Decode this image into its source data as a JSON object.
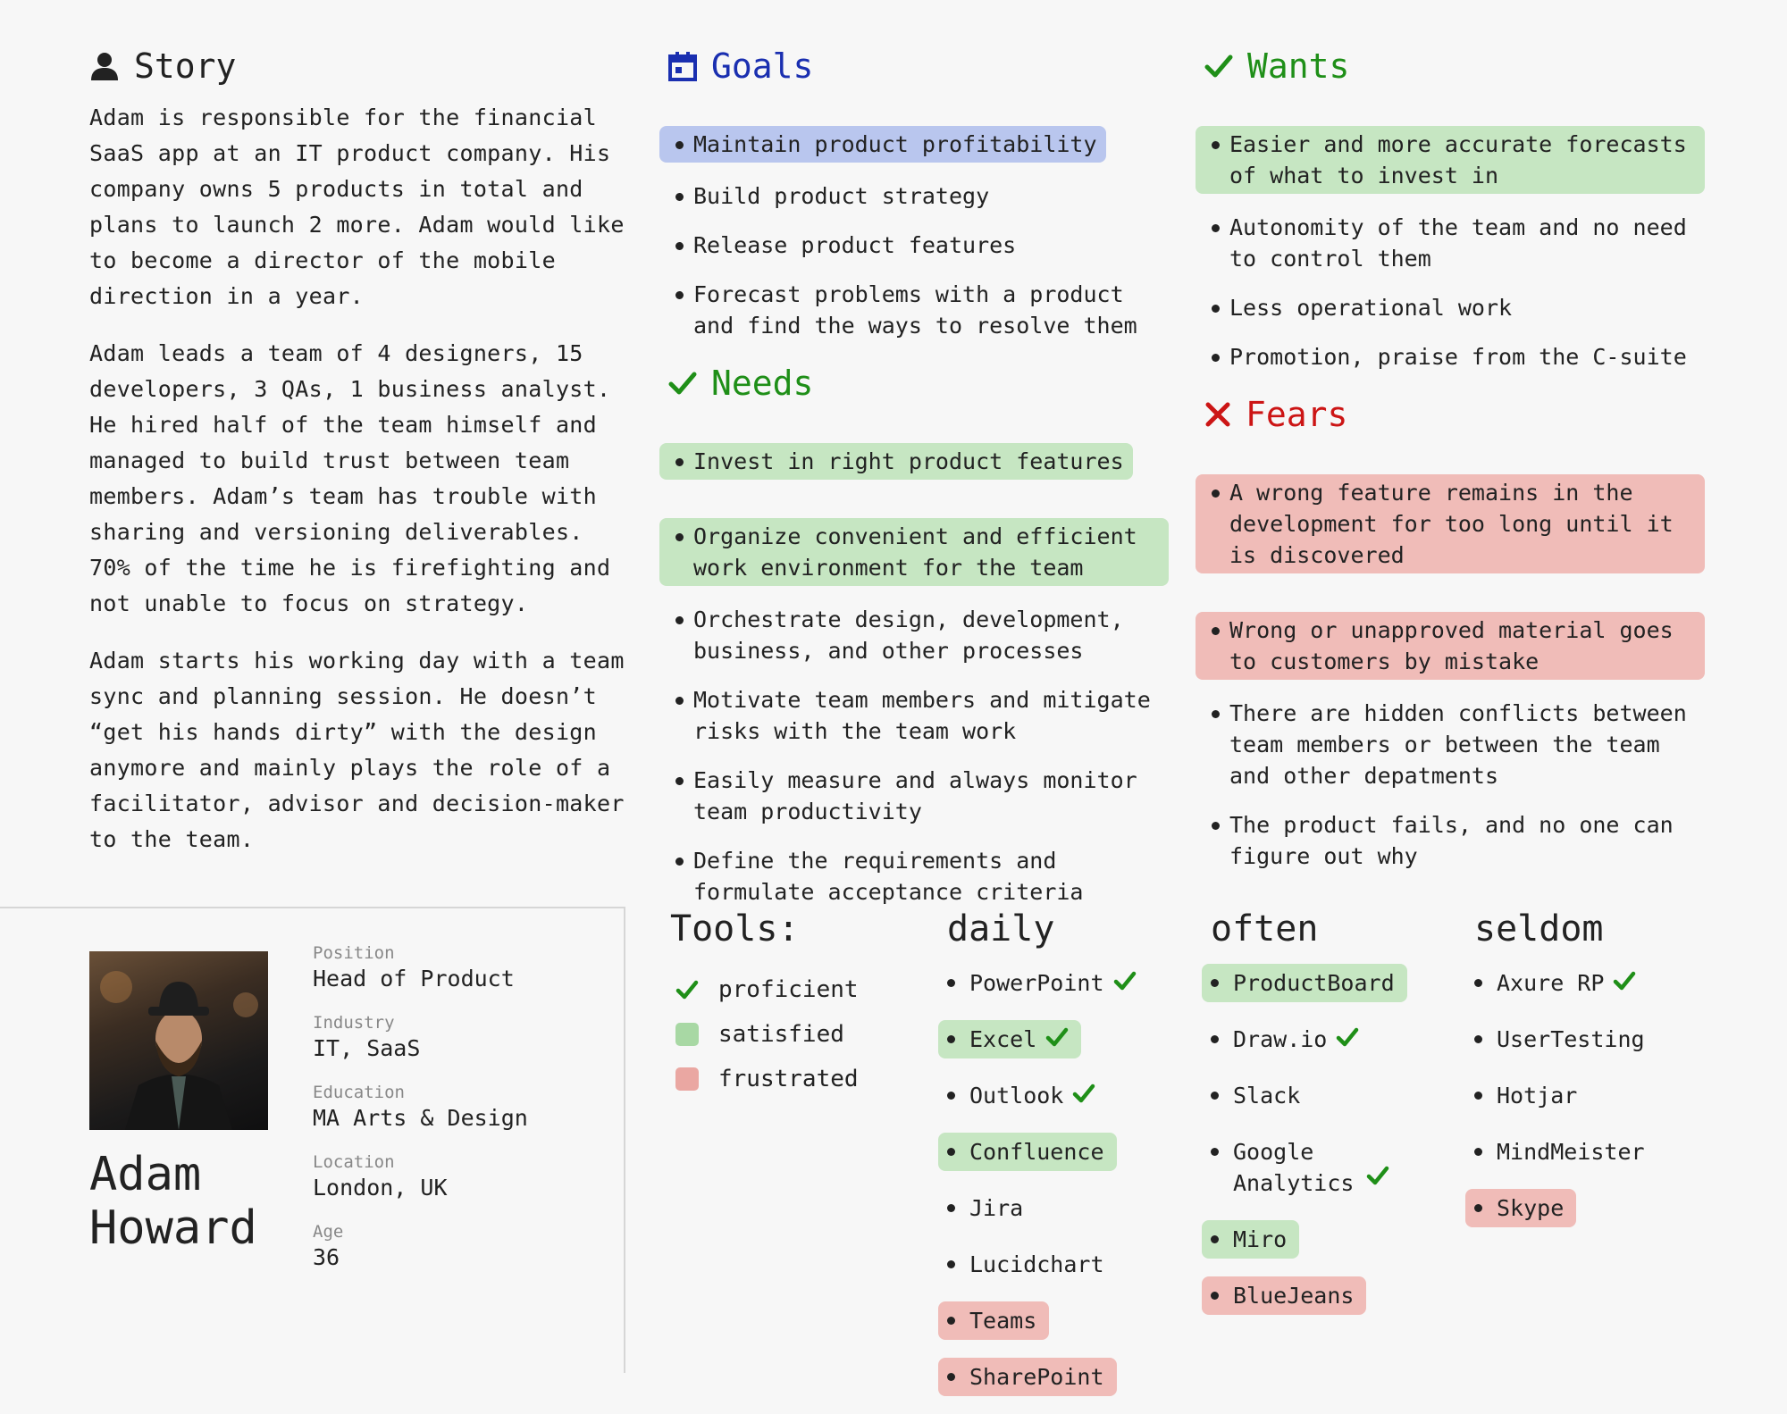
{
  "colors": {
    "goals_accent": "#1a2fb0",
    "wants_needs_accent": "#1f8f18",
    "fears_accent": "#cc1515",
    "highlight_blue": "#b9c6ee",
    "highlight_green": "#c6e6c2",
    "highlight_red": "#f0bcb8"
  },
  "story": {
    "icon": "user-icon",
    "title": "Story",
    "paragraphs": [
      "Adam is responsible for the financial SaaS app at an IT product company. His company owns 5 products in total and plans to launch 2 more. Adam would like to become a director of the mobile direction in a year.",
      "Adam leads a team of 4 designers, 15 developers, 3 QAs, 1 business analyst. He hired half of the team himself and managed to build trust between team members. Adam’s team has trouble with sharing and versioning deliverables. 70% of the time he is firefighting and not unable to focus on strategy.",
      "Adam starts his working day with a team sync and planning session. He doesn’t “get his hands dirty” with the design anymore and mainly plays the role of a facilitator, advisor and decision-maker to the team."
    ]
  },
  "goals": {
    "icon": "calendar-icon",
    "title": "Goals",
    "items": [
      {
        "text": "Maintain product profitability",
        "highlight": "blue"
      },
      {
        "text": "Build product strategy",
        "highlight": ""
      },
      {
        "text": "Release product features",
        "highlight": ""
      },
      {
        "text": "Forecast problems with a product and find the ways to resolve them",
        "highlight": ""
      }
    ]
  },
  "needs": {
    "icon": "check-icon",
    "title": "Needs",
    "items": [
      {
        "text": "Invest in right product features",
        "highlight": "green"
      },
      {
        "text": "Organize convenient and efficient work environment for the team",
        "highlight": "green"
      },
      {
        "text": "Orchestrate design, development, business, and other processes",
        "highlight": ""
      },
      {
        "text": "Motivate team members and mitigate risks with the team work",
        "highlight": ""
      },
      {
        "text": "Easily measure and always monitor team productivity",
        "highlight": ""
      },
      {
        "text": "Define the requirements and formulate acceptance criteria",
        "highlight": ""
      }
    ]
  },
  "wants": {
    "icon": "check-icon",
    "title": "Wants",
    "items": [
      {
        "text": "Easier and more accurate forecasts of what to invest in",
        "highlight": "green"
      },
      {
        "text": "Autonomity of the team and no need to control them",
        "highlight": ""
      },
      {
        "text": "Less operational work",
        "highlight": ""
      },
      {
        "text": "Promotion, praise from the C-suite",
        "highlight": ""
      }
    ]
  },
  "fears": {
    "icon": "x-icon",
    "title": "Fears",
    "items": [
      {
        "text": "A wrong feature remains in the development for too long until it is discovered",
        "highlight": "red"
      },
      {
        "text": "Wrong or unapproved material goes to customers by mistake",
        "highlight": "red"
      },
      {
        "text": "There are hidden conflicts between team members or between the team and other depatments",
        "highlight": ""
      },
      {
        "text": "The product fails, and no one can figure out why",
        "highlight": ""
      }
    ]
  },
  "profile": {
    "name_line1": "Adam",
    "name_line2": "Howard",
    "fields": [
      {
        "label": "Position",
        "value": "Head of Product"
      },
      {
        "label": "Industry",
        "value": "IT, SaaS"
      },
      {
        "label": "Education",
        "value": "MA Arts & Design"
      },
      {
        "label": "Location",
        "value": "London, UK"
      },
      {
        "label": "Age",
        "value": "36"
      }
    ]
  },
  "tools": {
    "title": "Tools:",
    "legend": [
      {
        "label": "proficient",
        "kind": "check"
      },
      {
        "label": "satisfied",
        "kind": "green"
      },
      {
        "label": "frustrated",
        "kind": "red"
      }
    ],
    "columns": [
      {
        "title": "daily",
        "items": [
          {
            "text": "PowerPoint",
            "proficient": true,
            "highlight": ""
          },
          {
            "text": "Excel",
            "proficient": true,
            "highlight": "green"
          },
          {
            "text": "Outlook",
            "proficient": true,
            "highlight": ""
          },
          {
            "text": "Confluence",
            "proficient": false,
            "highlight": "green"
          },
          {
            "text": "Jira",
            "proficient": false,
            "highlight": ""
          },
          {
            "text": "Lucidchart",
            "proficient": false,
            "highlight": ""
          },
          {
            "text": "Teams",
            "proficient": false,
            "highlight": "red"
          },
          {
            "text": "SharePoint",
            "proficient": false,
            "highlight": "red"
          }
        ]
      },
      {
        "title": "often",
        "items": [
          {
            "text": "ProductBoard",
            "proficient": false,
            "highlight": "green"
          },
          {
            "text": "Draw.io",
            "proficient": true,
            "highlight": ""
          },
          {
            "text": "Slack",
            "proficient": false,
            "highlight": ""
          },
          {
            "text": "Google Analytics",
            "proficient": true,
            "highlight": ""
          },
          {
            "text": "Miro",
            "proficient": false,
            "highlight": "green"
          },
          {
            "text": "BlueJeans",
            "proficient": false,
            "highlight": "red"
          }
        ]
      },
      {
        "title": "seldom",
        "items": [
          {
            "text": "Axure RP",
            "proficient": true,
            "highlight": ""
          },
          {
            "text": "UserTesting",
            "proficient": false,
            "highlight": ""
          },
          {
            "text": "Hotjar",
            "proficient": false,
            "highlight": ""
          },
          {
            "text": "MindMeister",
            "proficient": false,
            "highlight": ""
          },
          {
            "text": "Skype",
            "proficient": false,
            "highlight": "red"
          }
        ]
      }
    ]
  }
}
